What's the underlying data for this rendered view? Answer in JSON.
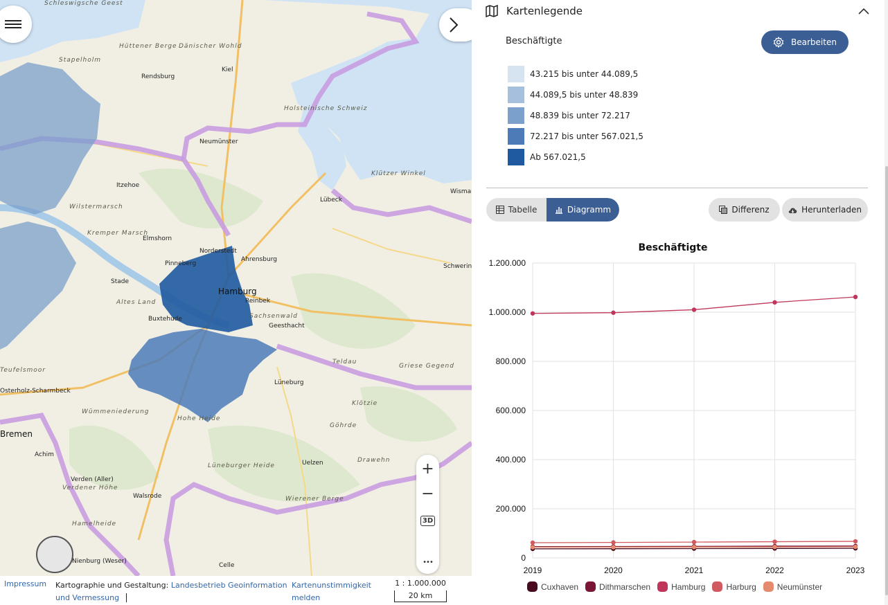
{
  "map": {
    "labels": [
      {
        "text": "Schleswigsche Geest",
        "cls": "region"
      },
      {
        "text": "Hüttener Berge",
        "cls": "region"
      },
      {
        "text": "Dänischer Wohld",
        "cls": "region"
      },
      {
        "text": "Stapelholm",
        "cls": "region"
      },
      {
        "text": "Rendsburg",
        "cls": "city"
      },
      {
        "text": "Kiel",
        "cls": "city"
      },
      {
        "text": "Holsteinische Schweiz",
        "cls": "region"
      },
      {
        "text": "Neumünster",
        "cls": "city"
      },
      {
        "text": "Itzehoe",
        "cls": "city"
      },
      {
        "text": "Wilstermarsch",
        "cls": "region"
      },
      {
        "text": "Kremper Marsch",
        "cls": "region"
      },
      {
        "text": "Elmshorn",
        "cls": "city"
      },
      {
        "text": "Norderstedt",
        "cls": "city"
      },
      {
        "text": "Ahrensburg",
        "cls": "city"
      },
      {
        "text": "Lübeck",
        "cls": "city"
      },
      {
        "text": "Klützer Winkel",
        "cls": "region"
      },
      {
        "text": "Wismar",
        "cls": "city"
      },
      {
        "text": "Schwerin",
        "cls": "city"
      },
      {
        "text": "Pinneberg",
        "cls": "city"
      },
      {
        "text": "Hamburg",
        "cls": "big"
      },
      {
        "text": "Reinbek",
        "cls": "city"
      },
      {
        "text": "Stade",
        "cls": "city"
      },
      {
        "text": "Altes Land",
        "cls": "region"
      },
      {
        "text": "Sachsenwald",
        "cls": "region"
      },
      {
        "text": "Buxtehude",
        "cls": "city"
      },
      {
        "text": "Geesthacht",
        "cls": "city"
      },
      {
        "text": "Teldau",
        "cls": "region"
      },
      {
        "text": "Griese Gegend",
        "cls": "region"
      },
      {
        "text": "Lüneburg",
        "cls": "city"
      },
      {
        "text": "Klötzie",
        "cls": "region"
      },
      {
        "text": "Teufelsmoor",
        "cls": "region"
      },
      {
        "text": "Osterholz-Scharmbeck",
        "cls": "city"
      },
      {
        "text": "Wümmeniederung",
        "cls": "region"
      },
      {
        "text": "Hohe Heide",
        "cls": "region"
      },
      {
        "text": "Göhrde",
        "cls": "region"
      },
      {
        "text": "Bremen",
        "cls": "big"
      },
      {
        "text": "Achim",
        "cls": "city"
      },
      {
        "text": "Lüneburger Heide",
        "cls": "region"
      },
      {
        "text": "Uelzen",
        "cls": "city"
      },
      {
        "text": "Drawehn",
        "cls": "region"
      },
      {
        "text": "Verden (Aller)",
        "cls": "city"
      },
      {
        "text": "Verdener Höhe",
        "cls": "region"
      },
      {
        "text": "Walsrode",
        "cls": "city"
      },
      {
        "text": "Wierener Berge",
        "cls": "region"
      },
      {
        "text": "Hamelheide",
        "cls": "region"
      },
      {
        "text": "Celle",
        "cls": "city"
      },
      {
        "text": "Nienburg (Weser)",
        "cls": "city"
      }
    ]
  },
  "zoom": {
    "plus": "+",
    "minus": "−",
    "btn3d": "3D",
    "more": "•••"
  },
  "footer": {
    "impressum": "Impressum",
    "credit_prefix": "Kartographie und Gestaltung: ",
    "credit_link": "Landesbetrieb Geoinformation und Vermessung",
    "kart_link": "Kartenunstimmigkeit melden",
    "scale_ratio": "1 : 1.000.000",
    "scale_bar": "20 km"
  },
  "legend": {
    "title": "Kartenlegende",
    "attribute": "Beschäftigte",
    "edit_label": "Bearbeiten",
    "classes": [
      {
        "label": "43.215 bis unter 44.089,5",
        "color": "#d6e3f0"
      },
      {
        "label": "44.089,5 bis unter 48.839",
        "color": "#a6bfdc"
      },
      {
        "label": "48.839 bis unter 72.217",
        "color": "#7ba0cb"
      },
      {
        "label": "72.217 bis unter 567.021,5",
        "color": "#4c7bb8"
      },
      {
        "label": "Ab 567.021,5",
        "color": "#1f5aa0"
      }
    ]
  },
  "tabs": {
    "table": "Tabelle",
    "chart": "Diagramm"
  },
  "actions": {
    "difference": "Differenz",
    "download": "Herunterladen"
  },
  "colors": {
    "accent": "#3b5e95",
    "border_purple": "#c89ce0",
    "sea": "#cfe3f5"
  },
  "chart_data": {
    "type": "line",
    "title": "Beschäftigte",
    "xlabel": "",
    "ylabel": "",
    "x": [
      2019,
      2020,
      2021,
      2022,
      2023
    ],
    "ylim": [
      0,
      1200000
    ],
    "yticks": [
      "0",
      "200.000",
      "400.000",
      "600.000",
      "800.000",
      "1.000.000",
      "1.200.000"
    ],
    "grid": true,
    "legend_position": "bottom",
    "series": [
      {
        "name": "Cuxhaven",
        "color": "#4a0a1e",
        "values": [
          37000,
          37500,
          38000,
          38500,
          39000
        ]
      },
      {
        "name": "Dithmarschen",
        "color": "#7a1535",
        "values": [
          46000,
          46500,
          47000,
          48000,
          48500
        ]
      },
      {
        "name": "Hamburg",
        "color": "#c0365a",
        "values": [
          995000,
          998000,
          1010000,
          1040000,
          1062000
        ]
      },
      {
        "name": "Harburg",
        "color": "#d05a5f",
        "values": [
          62000,
          63000,
          64500,
          66000,
          67500
        ]
      },
      {
        "name": "Neumünster",
        "color": "#e58a6c",
        "values": [
          43500,
          43800,
          44200,
          44600,
          45000
        ]
      }
    ]
  }
}
